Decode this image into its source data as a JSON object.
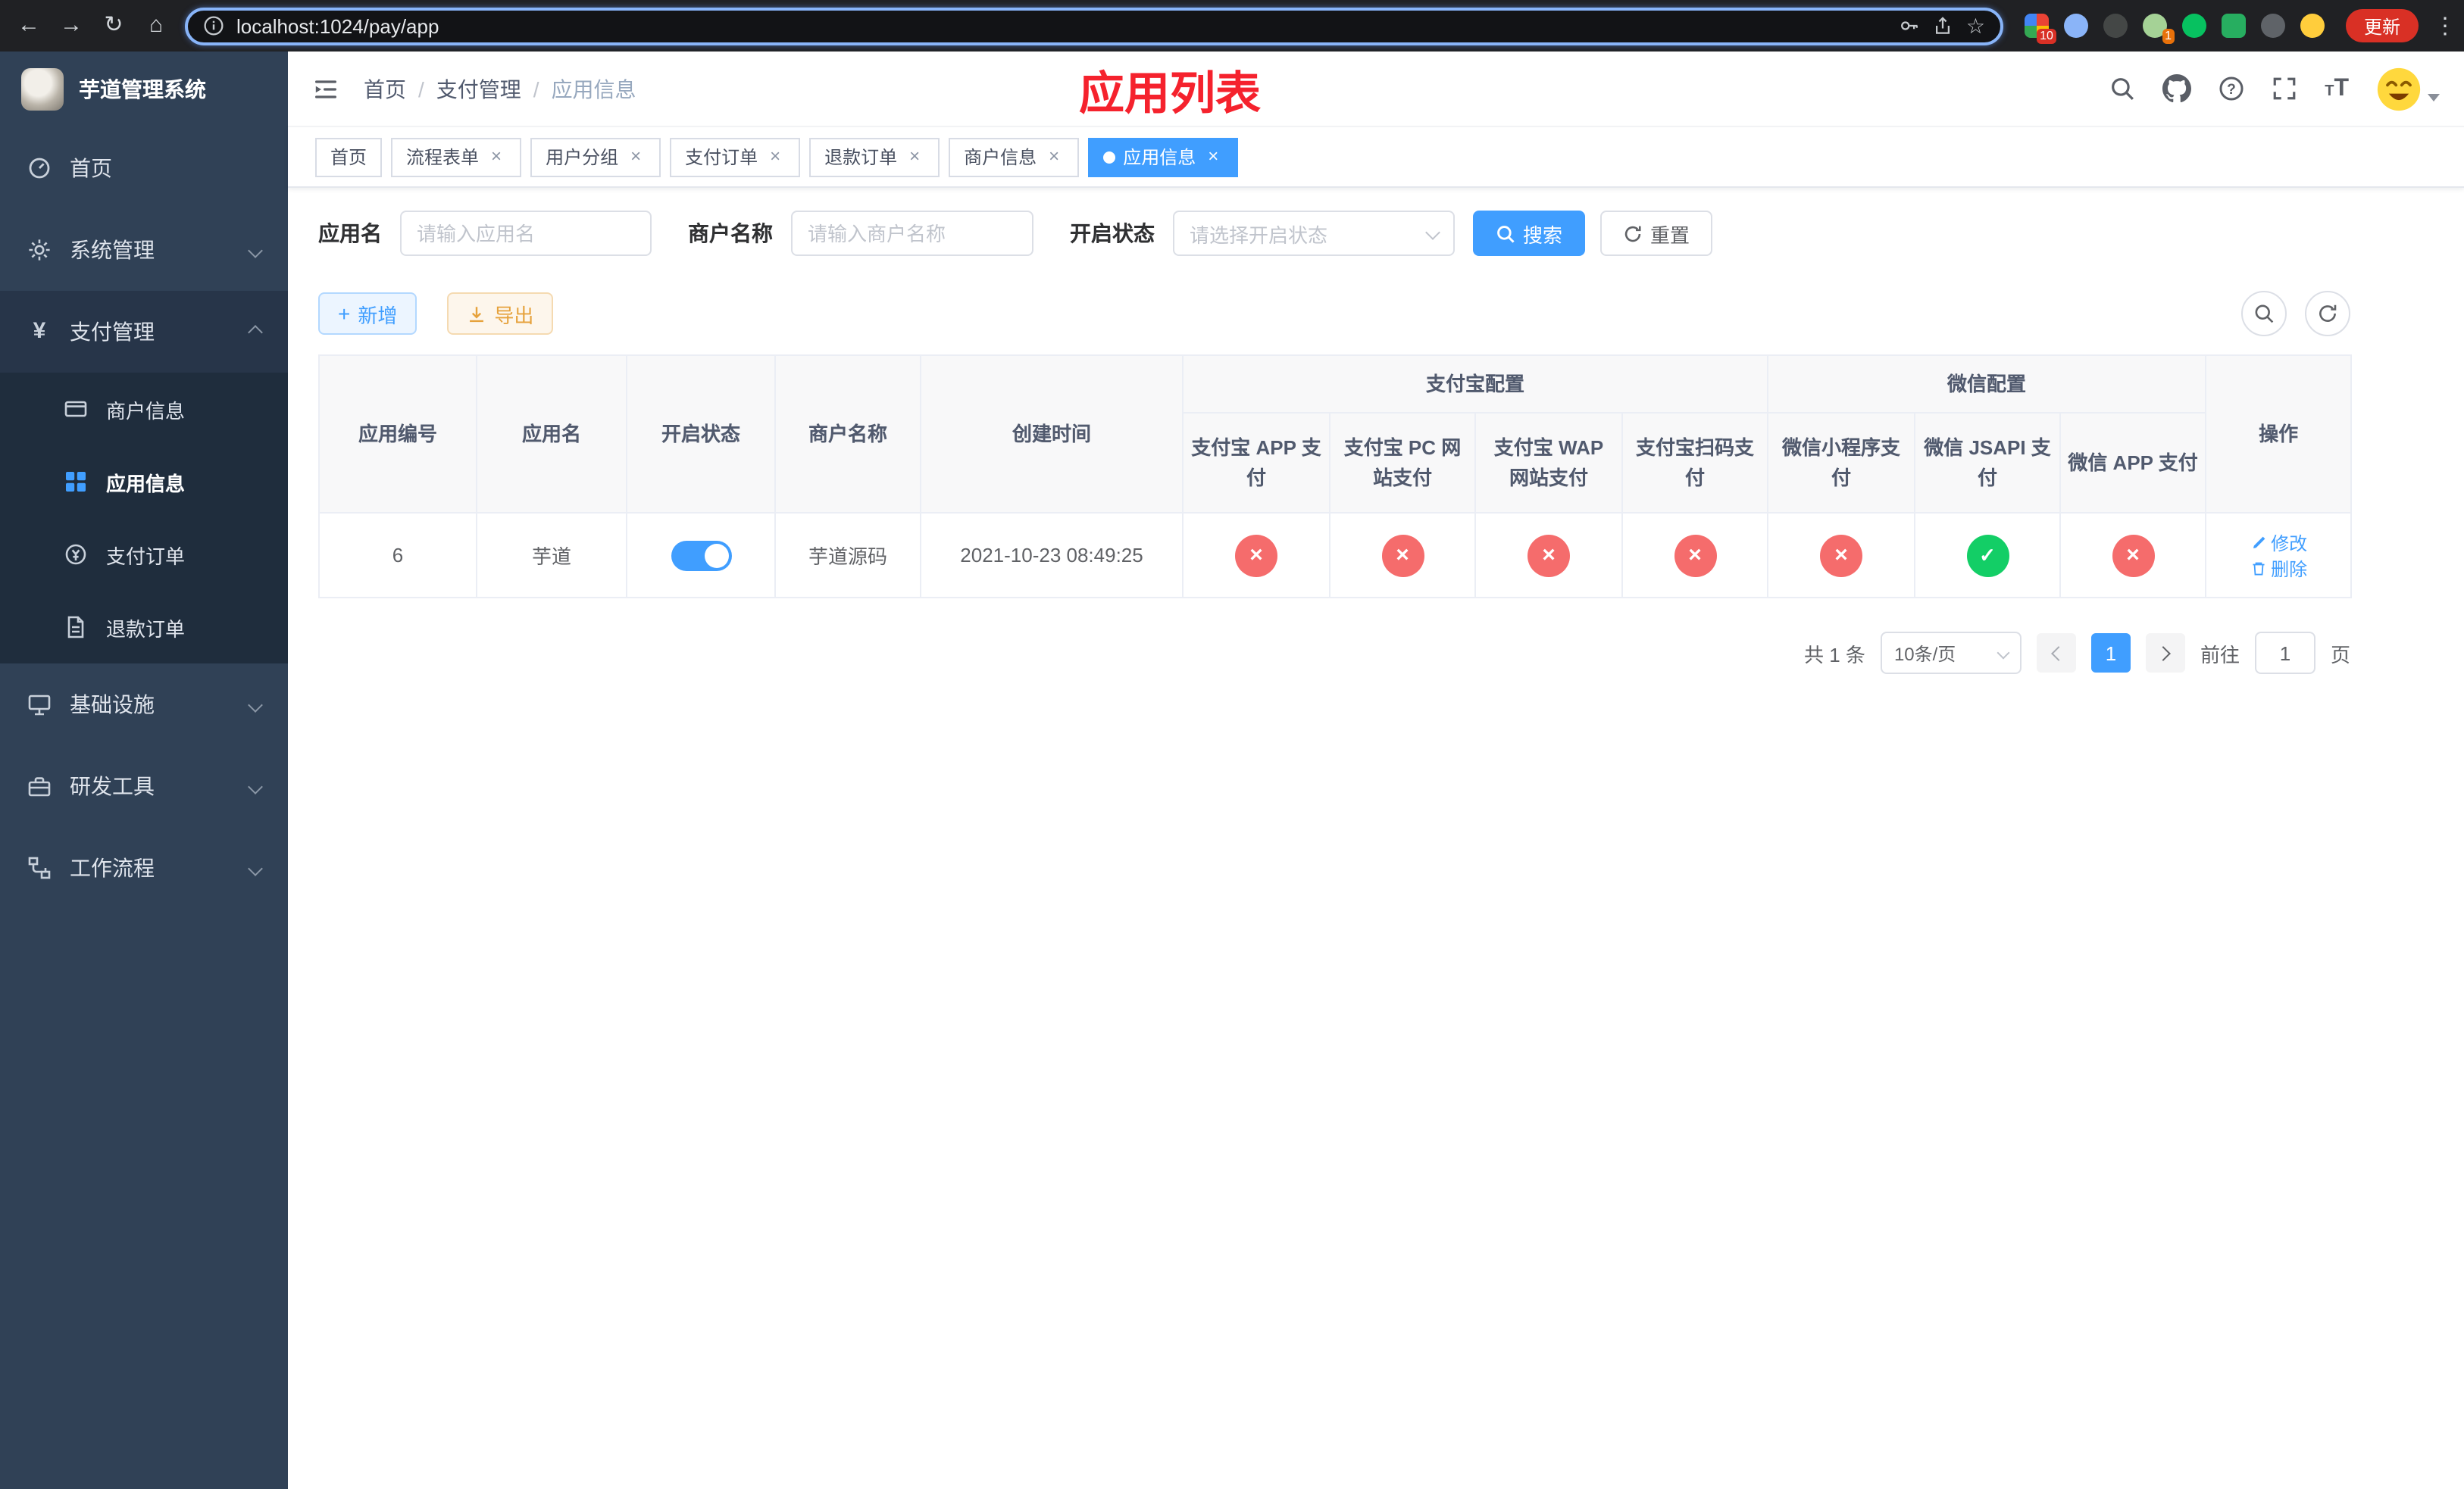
{
  "colors": {
    "primary": "#409eff",
    "danger": "#f56c6c",
    "success": "#13ce66",
    "title_red": "#f5222d",
    "sidebar_bg": "#304156",
    "submenu_bg": "#1f2d3d"
  },
  "browser": {
    "url": "localhost:1024/pay/app",
    "update_label": "更新",
    "ext_badge_red": "10",
    "ext_badge_orange": "1"
  },
  "app_title": "芋道管理系统",
  "sidebar": {
    "items": [
      {
        "label": "首页"
      },
      {
        "label": "系统管理"
      },
      {
        "label": "支付管理"
      },
      {
        "label": "基础设施"
      },
      {
        "label": "研发工具"
      },
      {
        "label": "工作流程"
      }
    ],
    "pay_children": [
      {
        "label": "商户信息"
      },
      {
        "label": "应用信息"
      },
      {
        "label": "支付订单"
      },
      {
        "label": "退款订单"
      }
    ]
  },
  "header": {
    "breadcrumb": [
      "首页",
      "支付管理",
      "应用信息"
    ],
    "page_title": "应用列表"
  },
  "tabs": [
    {
      "label": "首页"
    },
    {
      "label": "流程表单"
    },
    {
      "label": "用户分组"
    },
    {
      "label": "支付订单"
    },
    {
      "label": "退款订单"
    },
    {
      "label": "商户信息"
    },
    {
      "label": "应用信息"
    }
  ],
  "filter": {
    "app_name_label": "应用名",
    "app_name_placeholder": "请输入应用名",
    "merchant_label": "商户名称",
    "merchant_placeholder": "请输入商户名称",
    "status_label": "开启状态",
    "status_placeholder": "请选择开启状态",
    "search_label": "搜索",
    "reset_label": "重置"
  },
  "toolbar": {
    "add_label": "新增",
    "export_label": "导出"
  },
  "table": {
    "col_app_id": "应用编号",
    "col_app_name": "应用名",
    "col_status": "开启状态",
    "col_merchant": "商户名称",
    "col_created": "创建时间",
    "group_alipay": "支付宝配置",
    "group_wechat": "微信配置",
    "col_alipay_app": "支付宝 APP 支付",
    "col_alipay_pc": "支付宝 PC 网站支付",
    "col_alipay_wap": "支付宝 WAP 网站支付",
    "col_alipay_qr": "支付宝扫码支付",
    "col_wx_mini": "微信小程序支付",
    "col_wx_jsapi": "微信 JSAPI 支付",
    "col_wx_app": "微信 APP 支付",
    "col_actions": "操作",
    "rows": [
      {
        "app_id": "6",
        "app_name": "芋道",
        "status_on": true,
        "merchant": "芋道源码",
        "created": "2021-10-23 08:49:25",
        "alipay_app": false,
        "alipay_pc": false,
        "alipay_wap": false,
        "alipay_qr": false,
        "wx_mini": false,
        "wx_jsapi": true,
        "wx_app": false,
        "edit_label": "修改",
        "delete_label": "删除"
      }
    ]
  },
  "pagination": {
    "total_label": "共 1 条",
    "page_size_label": "10条/页",
    "current_page": "1",
    "goto_label": "前往",
    "goto_value": "1",
    "page_unit": "页"
  }
}
